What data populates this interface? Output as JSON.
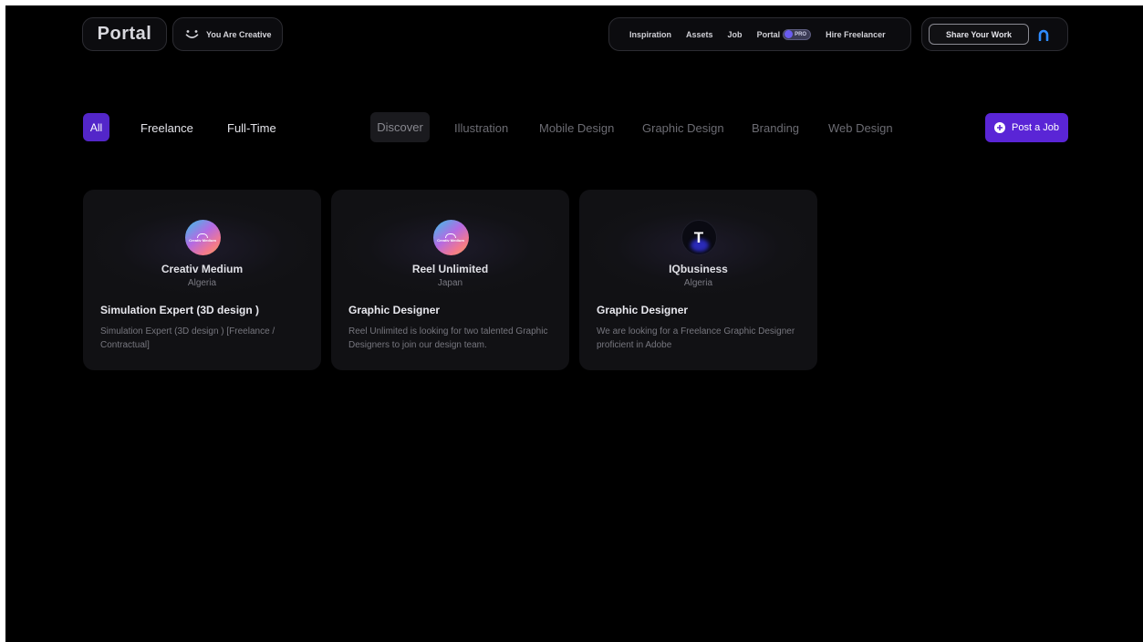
{
  "header": {
    "logo": "Portal",
    "tagline": "You Are Creative",
    "nav": [
      "Inspiration",
      "Assets",
      "Job",
      "Portal",
      "Hire Freelancer"
    ],
    "pro_badge": "PRO",
    "share_label": "Share Your Work"
  },
  "filters": {
    "types": [
      "All",
      "Freelance",
      "Full-Time"
    ],
    "categories": [
      "Discover",
      "Illustration",
      "Mobile Design",
      "Graphic Design",
      "Branding",
      "Web Design"
    ],
    "post_job_label": "Post a Job"
  },
  "jobs": [
    {
      "logo_text": "Creativ Medium",
      "company": "Creativ Medium",
      "country": "Algeria",
      "title": "Simulation Expert (3D design )",
      "description": "Simulation Expert (3D design ) [Freelance / Contractual]"
    },
    {
      "logo_text": "Creativ Medium",
      "company": "Reel Unlimited",
      "country": "Japan",
      "title": "Graphic Designer",
      "description": "Reel Unlimited is looking for two talented Graphic Designers to join our design team."
    },
    {
      "logo_text": "T",
      "company": "IQbusiness",
      "country": "Algeria",
      "title": "Graphic Designer",
      "description": "We are looking for a Freelance Graphic Designer proficient in Adobe"
    }
  ],
  "colors": {
    "background": "#000000",
    "accent": "#5a25d6",
    "card": "#121216"
  }
}
